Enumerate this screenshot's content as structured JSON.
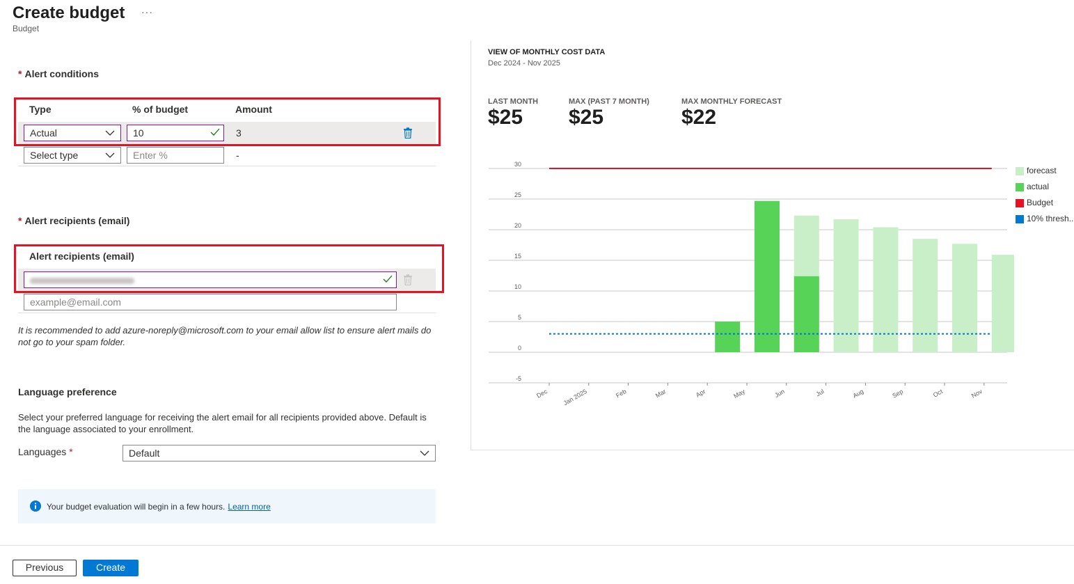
{
  "header": {
    "title": "Create budget",
    "more_label": "···",
    "subtitle": "Budget"
  },
  "alert_conditions": {
    "required_mark": "*",
    "label": "Alert conditions",
    "columns": {
      "type": "Type",
      "percent": "% of budget",
      "amount": "Amount"
    },
    "rows": [
      {
        "type": "Actual",
        "percent": "10",
        "amount": "3"
      },
      {
        "type_placeholder": "Select type",
        "percent_placeholder": "Enter %",
        "amount": "-"
      }
    ]
  },
  "alert_recipients": {
    "required_mark": "*",
    "label": "Alert recipients (email)",
    "column_header": "Alert recipients (email)",
    "new_placeholder": "example@email.com"
  },
  "note": "It is recommended to add azure-noreply@microsoft.com to your email allow list to ensure alert mails do not go to your spam folder.",
  "language": {
    "heading": "Language preference",
    "description": "Select your preferred language for receiving the alert email for all recipients provided above. Default is the language associated to your enrollment.",
    "label": "Languages",
    "required_mark": "*",
    "selected": "Default"
  },
  "info_bar": {
    "text": "Your budget evaluation will begin in a few hours.",
    "link": "Learn more"
  },
  "footer": {
    "previous": "Previous",
    "create": "Create"
  },
  "chart_panel": {
    "title": "VIEW OF MONTHLY COST DATA",
    "range": "Dec 2024 - Nov 2025",
    "kpis": [
      {
        "label": "LAST MONTH",
        "value": "$25"
      },
      {
        "label": "MAX (PAST 7 MONTH)",
        "value": "$25"
      },
      {
        "label": "MAX MONTHLY FORECAST",
        "value": "$22"
      }
    ]
  },
  "colors": {
    "forecast": "#c8efc8",
    "actual": "#57d357",
    "budget": "#e81123",
    "threshold": "#0078d4",
    "highlight": "#e81123",
    "primary": "#0078d4"
  },
  "chart_data": {
    "type": "bar",
    "categories": [
      "Dec",
      "Jan 2025",
      "Feb",
      "Mar",
      "Apr",
      "May",
      "Jun",
      "Jul",
      "Aug",
      "Sep",
      "Oct",
      "Nov"
    ],
    "series": [
      {
        "name": "forecast",
        "values": [
          null,
          null,
          null,
          null,
          null,
          null,
          22.3,
          21.7,
          20.4,
          18.5,
          17.7,
          15.9
        ]
      },
      {
        "name": "actual",
        "values": [
          null,
          null,
          null,
          null,
          5,
          24.7,
          12.4,
          null,
          null,
          null,
          null,
          null
        ]
      },
      {
        "name": "Budget",
        "line": 30
      },
      {
        "name": "10% thresh...",
        "line": 3
      }
    ],
    "yticks": [
      30,
      25,
      20,
      15,
      10,
      5,
      0,
      -5
    ],
    "ylim": [
      -5,
      30
    ],
    "legend": "right"
  }
}
